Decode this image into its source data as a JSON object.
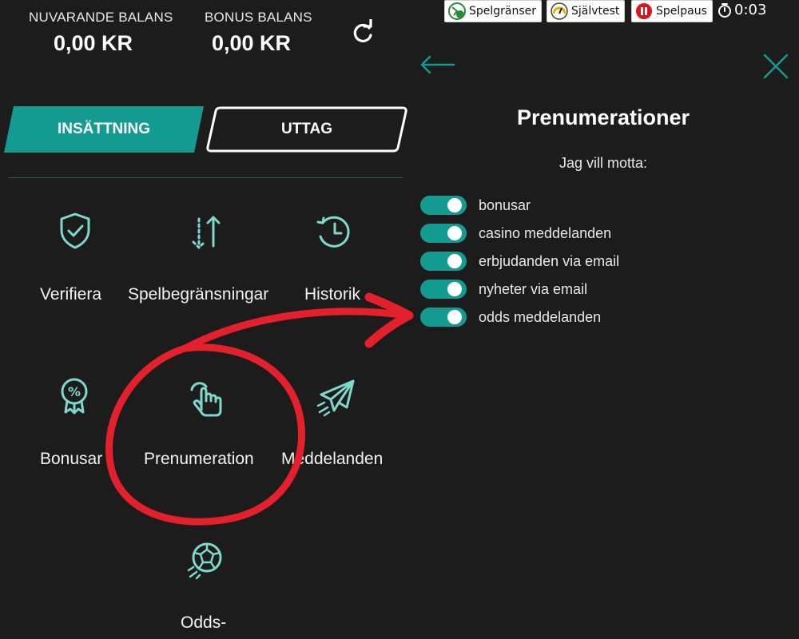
{
  "balance": {
    "current_label": "NUVARANDE BALANS",
    "current_value": "0,00 KR",
    "bonus_label": "BONUS BALANS",
    "bonus_value": "0,00 KR"
  },
  "actions": {
    "deposit_label": "INSÄTTNING",
    "withdraw_label": "UTTAG"
  },
  "menu": {
    "items": [
      {
        "label": "Verifiera",
        "icon": "shield-check-icon"
      },
      {
        "label": "Spelbegränsningar",
        "icon": "arrows-up-down-icon"
      },
      {
        "label": "Historik",
        "icon": "clock-history-icon"
      },
      {
        "label": "Bonusar",
        "icon": "percent-badge-icon"
      },
      {
        "label": "Prenumeration",
        "icon": "hand-tap-icon"
      },
      {
        "label": "Meddelanden",
        "icon": "paper-plane-icon"
      },
      {
        "label": "Odds-",
        "icon": "soccer-ball-icon"
      }
    ]
  },
  "topbar": {
    "spelgranser": "Spelgränser",
    "sjalvtest": "Självtest",
    "spelpaus": "Spelpaus",
    "timer": "0:03"
  },
  "subscriptions": {
    "title": "Prenumerationer",
    "subtitle": "Jag vill motta:",
    "toggles": [
      {
        "label": "bonusar",
        "on": true
      },
      {
        "label": "casino meddelanden",
        "on": true
      },
      {
        "label": "erbjudanden via email",
        "on": true
      },
      {
        "label": "nyheter via email",
        "on": true
      },
      {
        "label": "odds meddelanden",
        "on": true
      }
    ]
  },
  "colors": {
    "accent": "#139a91",
    "icon": "#7fd8cd",
    "background": "#1c1c1c",
    "annotation": "#e3202c"
  }
}
